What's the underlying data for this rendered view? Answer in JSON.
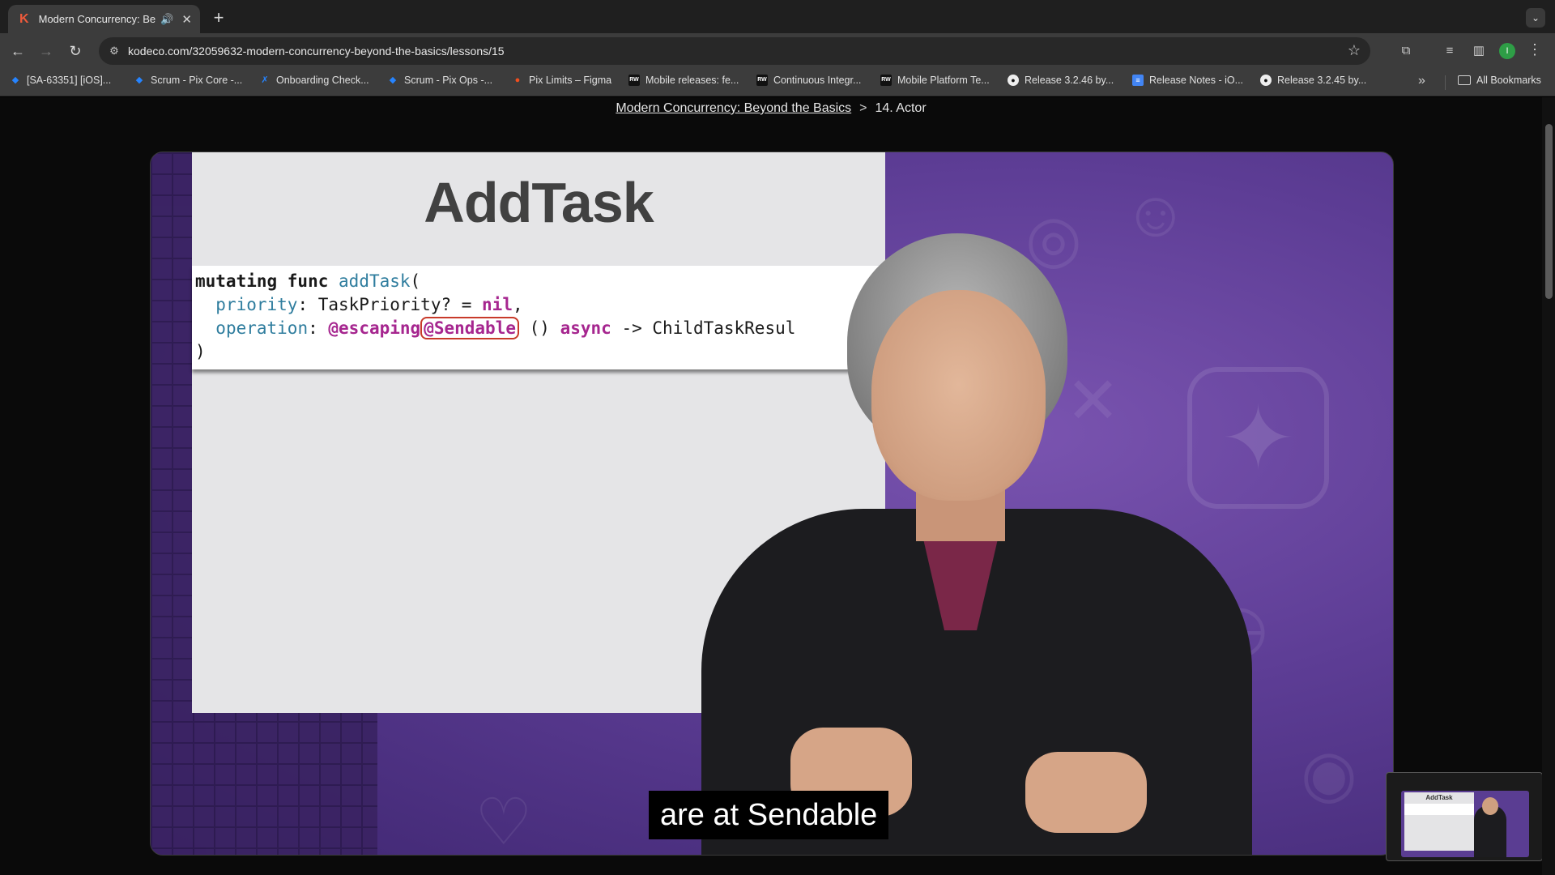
{
  "tab": {
    "title": "Modern Concurrency: Beyond the Basics",
    "favicon_letter": "K"
  },
  "toolbar": {
    "url": "kodeco.com/32059632-modern-concurrency-beyond-the-basics/lessons/15",
    "profile_initial": "I"
  },
  "bookmarks": [
    {
      "label": "[SA-63351] [iOS]...",
      "icon": "jira-icon"
    },
    {
      "label": "Scrum - Pix Core -...",
      "icon": "jira-icon"
    },
    {
      "label": "Onboarding Check...",
      "icon": "jira-icon"
    },
    {
      "label": "Scrum - Pix Ops -...",
      "icon": "jira-icon"
    },
    {
      "label": "Pix Limits – Figma",
      "icon": "figma-icon"
    },
    {
      "label": "Mobile releases: fe...",
      "icon": "rw-icon"
    },
    {
      "label": "Continuous Integr...",
      "icon": "rw-icon"
    },
    {
      "label": "Mobile Platform Te...",
      "icon": "rw-icon"
    },
    {
      "label": "Release 3.2.46 by...",
      "icon": "github-icon"
    },
    {
      "label": "Release Notes - iO...",
      "icon": "docs-icon"
    },
    {
      "label": "Release 3.2.45 by...",
      "icon": "github-icon"
    }
  ],
  "bookmarks_all": "All Bookmarks",
  "breadcrumb": {
    "course": "Modern Concurrency: Beyond the Basics",
    "separator": ">",
    "lesson": "14. Actor"
  },
  "slide": {
    "title": "AddTask",
    "code": {
      "line1_kw": "mutating func",
      "line1_name": "addTask",
      "line1_paren": "(",
      "line2_param": "priority",
      "line2_type": ": TaskPriority? = ",
      "line2_nil": "nil",
      "line2_comma": ",",
      "line3_param": "operation",
      "line3_colon": ": ",
      "line3_escaping": "@escaping",
      "line3_sendable": "@Sendable",
      "line3_parens": " ()",
      "line3_async": "async",
      "line3_rest": " -> ChildTaskResul",
      "line4": ")"
    }
  },
  "caption": "are at Sendable",
  "thumbnail": {
    "slide_title": "AddTask"
  },
  "colors": {
    "accent_highlight": "#c83a2a",
    "video_purple": "#5d3d95",
    "code_teal": "#2f7d9e",
    "code_purple": "#a6268f"
  }
}
